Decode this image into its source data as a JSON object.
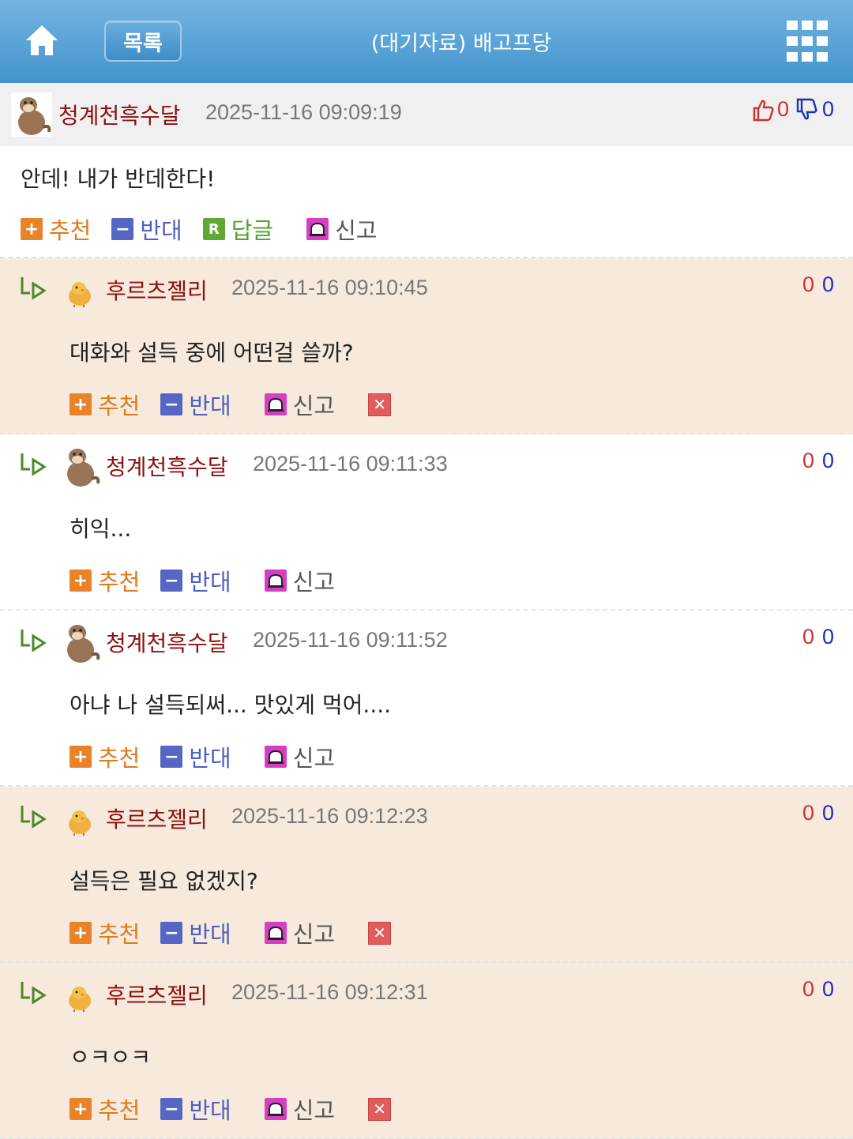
{
  "header": {
    "list_label": "목록",
    "title": "(대기자료) 배고프당",
    "icons": [
      "home-icon",
      "grid-menu-icon"
    ],
    "color": "#4393cc"
  },
  "post": {
    "author": "청계천흑수달",
    "time": "2025-11-16 09:09:19",
    "up": "0",
    "down": "0",
    "content": "안데! 내가 반데한다!",
    "actions": {
      "recommend": "추천",
      "oppose": "반대",
      "reply": "답글",
      "report": "신고"
    }
  },
  "comments": [
    {
      "author": "후르츠젤리",
      "time": "2025-11-16 09:10:45",
      "up": "0",
      "down": "0",
      "content": "대화와 설득 중에 어떤걸 쓸까?",
      "recommend": "추천",
      "oppose": "반대",
      "report": "신고",
      "avatar": "chick"
    },
    {
      "author": "청계천흑수달",
      "time": "2025-11-16 09:11:33",
      "up": "0",
      "down": "0",
      "content": "히익...",
      "recommend": "추천",
      "oppose": "반대",
      "report": "신고",
      "avatar": "otter"
    },
    {
      "author": "청계천흑수달",
      "time": "2025-11-16 09:11:52",
      "up": "0",
      "down": "0",
      "content": "아냐 나 설득되써... 맛있게 먹어....",
      "recommend": "추천",
      "oppose": "반대",
      "report": "신고",
      "avatar": "otter"
    },
    {
      "author": "후르츠젤리",
      "time": "2025-11-16 09:12:23",
      "up": "0",
      "down": "0",
      "content": "설득은 필요 없겠지?",
      "recommend": "추천",
      "oppose": "반대",
      "report": "신고",
      "avatar": "chick"
    },
    {
      "author": "후르츠젤리",
      "time": "2025-11-16 09:12:31",
      "up": "0",
      "down": "0",
      "content": "ㅇㅋㅇㅋ",
      "recommend": "추천",
      "oppose": "반대",
      "report": "신고",
      "avatar": "chick"
    }
  ],
  "colors": {
    "author": "#8b1010",
    "tinted_bg": "#f7eadc",
    "recommend": "#e8832a",
    "oppose": "#5566c4",
    "reply": "#5ea833",
    "report": "#d63fc4",
    "delete": "#e25c5c"
  }
}
